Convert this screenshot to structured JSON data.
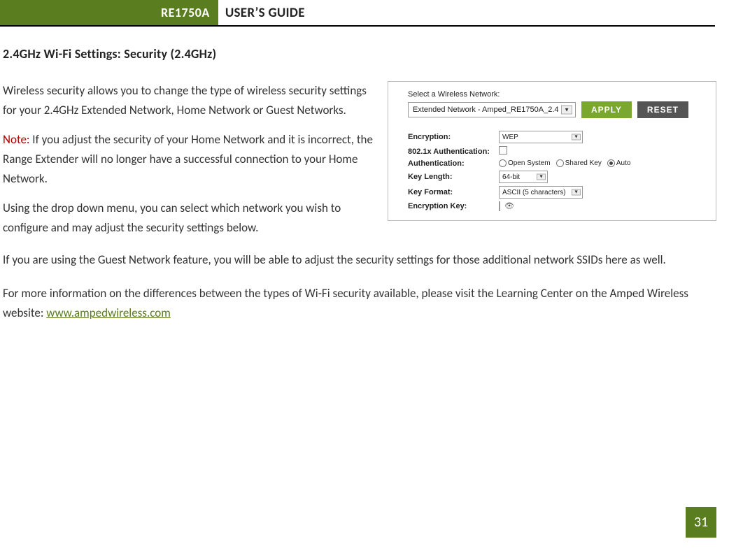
{
  "header": {
    "model": "RE1750A",
    "title": "USER’S GUIDE"
  },
  "section_heading": "2.4GHz Wi-Fi Settings: Security (2.4GHz)",
  "paragraphs": {
    "p1": "Wireless security allows you to change the type of wireless security settings for your 2.4GHz Extended Network, Home Network or Guest Networks.",
    "note_label": "Note:",
    "p2_after_note": " If you adjust the security of your Home Network and it is incorrect, the Range Extender will no longer have a successful connection to your Home Network.",
    "p3": "Using the drop down menu, you can select which network you wish to configure and may adjust the security settings below.",
    "p4": "If you are using the Guest Network feature, you will be able to adjust the security settings for those additional network SSIDs here as well.",
    "p5_pre": "For more information on the differences between the types of Wi-Fi security available, please visit the Learning Center on the Amped Wireless website: ",
    "p5_link": "www.ampedwireless.com"
  },
  "figure": {
    "select_label": "Select a Wireless Network:",
    "network_selected": "Extended Network - Amped_RE1750A_2.4",
    "apply": "APPLY",
    "reset": "RESET",
    "rows": {
      "encryption_label": "Encryption:",
      "encryption_value": "WEP",
      "dot1x_label": "802.1x Authentication:",
      "auth_label": "Authentication:",
      "auth_open": "Open System",
      "auth_shared": "Shared Key",
      "auth_auto": "Auto",
      "keylen_label": "Key Length:",
      "keylen_value": "64-bit",
      "keyfmt_label": "Key Format:",
      "keyfmt_value": "ASCII (5 characters)",
      "enckey_label": "Encryption Key:"
    }
  },
  "page_number": "31"
}
